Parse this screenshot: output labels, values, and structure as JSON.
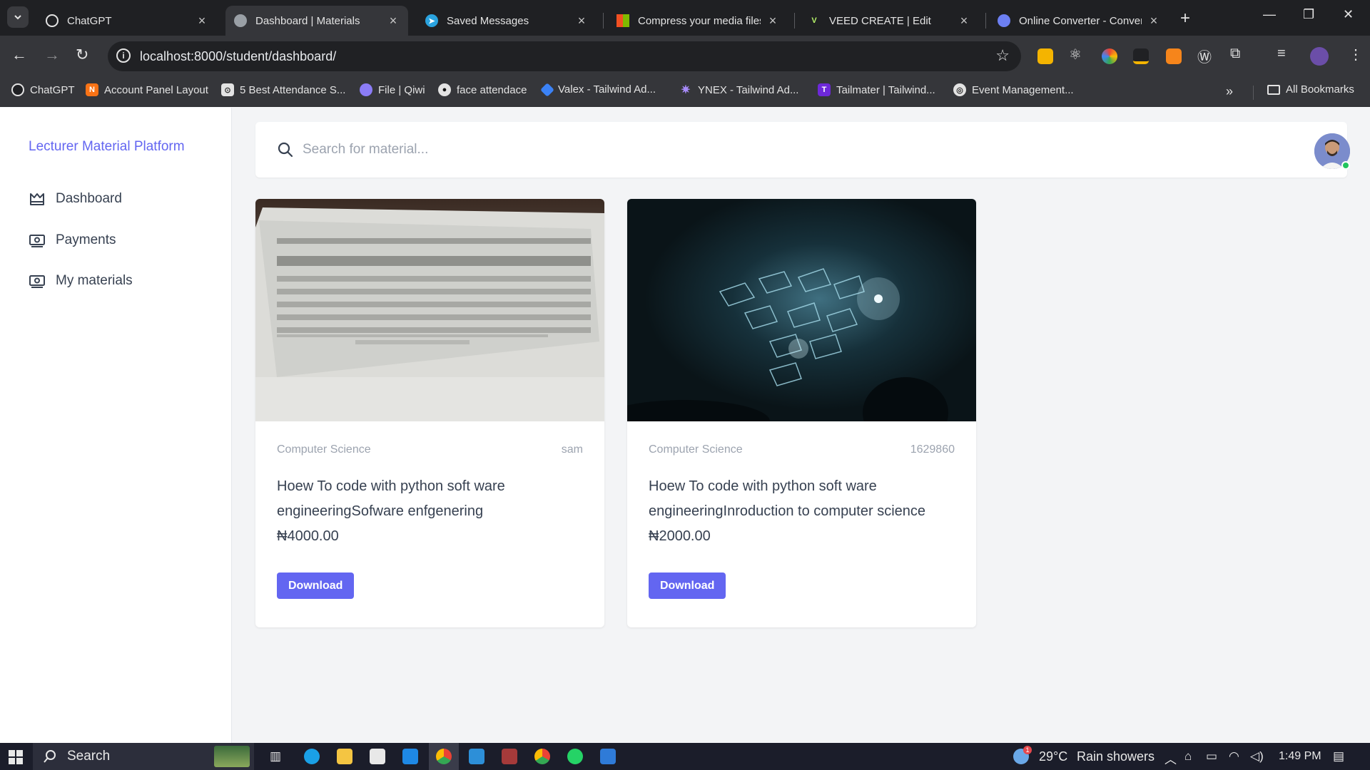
{
  "browser": {
    "tabs": [
      {
        "title": "ChatGPT",
        "active": false
      },
      {
        "title": "Dashboard | Materials",
        "active": true
      },
      {
        "title": "Saved Messages",
        "active": false
      },
      {
        "title": "Compress your media files",
        "active": false
      },
      {
        "title": "VEED CREATE | Edit",
        "active": false
      },
      {
        "title": "Online Converter - Convert",
        "active": false
      }
    ],
    "url": "localhost:8000/student/dashboard/",
    "bookmarks": [
      "ChatGPT",
      "Account Panel Layout",
      "5 Best Attendance S...",
      "File | Qiwi",
      "face attendace",
      "Valex - Tailwind Ad...",
      "YNEX - Tailwind Ad...",
      "Tailmater | Tailwind...",
      "Event Management..."
    ],
    "all_bookmarks": "All Bookmarks"
  },
  "sidebar": {
    "brand": "Lecturer Material Platform",
    "items": [
      {
        "label": "Dashboard",
        "icon": "dashboard-icon"
      },
      {
        "label": "Payments",
        "icon": "payments-icon"
      },
      {
        "label": "My materials",
        "icon": "materials-icon"
      }
    ]
  },
  "header": {
    "search_placeholder": "Search for material...",
    "search_value": ""
  },
  "materials": [
    {
      "category": "Computer Science",
      "author": "sam",
      "title": "Hoew To code with python soft ware engineeringSofware enfgenering",
      "price": "₦4000.00",
      "button": "Download"
    },
    {
      "category": "Computer Science",
      "author": "1629860",
      "title": "Hoew To code with python soft ware engineeringInroduction to computer science",
      "price": "₦2000.00",
      "button": "Download"
    }
  ],
  "taskbar": {
    "search_label": "Search",
    "weather_temp": "29°C",
    "weather_text": "Rain showers",
    "time": "1:49 PM",
    "weather_badge": "1"
  },
  "colors": {
    "accent": "#6366f1",
    "browser_dark": "#35363a",
    "page_bg": "#f3f4f6"
  }
}
